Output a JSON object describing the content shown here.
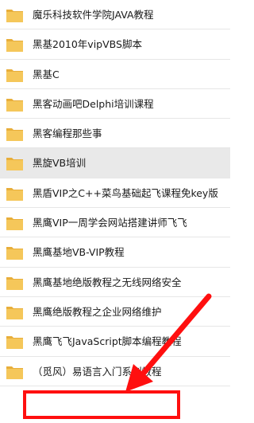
{
  "folders": [
    {
      "name": "魔乐科技软件学院JAVA教程"
    },
    {
      "name": "黑基2010年vipVBS脚本"
    },
    {
      "name": "黑基C"
    },
    {
      "name": "黑客动画吧Delphi培训课程"
    },
    {
      "name": "黑客编程那些事"
    },
    {
      "name": "黑旋VB培训"
    },
    {
      "name": "黑盾VIP之C++菜鸟基础起飞课程免key版"
    },
    {
      "name": "黑鹰VIP一周学会网站搭建讲师飞飞"
    },
    {
      "name": "黑鹰基地VB-VIP教程"
    },
    {
      "name": "黑鹰基地绝版教程之无线网络安全"
    },
    {
      "name": "黑鹰绝版教程之企业网络维护"
    },
    {
      "name": "黑鹰飞飞JavaScript脚本编程教程"
    },
    {
      "name": "（觅风）易语言入门系列教程"
    }
  ],
  "selected_index": 5,
  "highlighted_index": 12,
  "colors": {
    "folder_body": "#f5c75a",
    "folder_tab": "#e8ae3a",
    "annotation": "#ff0f0f",
    "selected_row": "#e9e9e9"
  },
  "icons": {
    "folder": "folder-icon",
    "annotation_arrow": "red-arrow-annotation"
  }
}
